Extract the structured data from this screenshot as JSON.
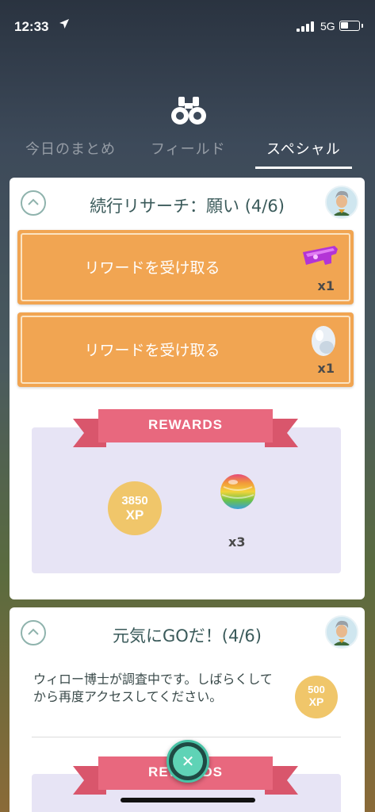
{
  "status_bar": {
    "time": "12:33",
    "network": "5G"
  },
  "tabs": [
    {
      "label": "今日のまとめ"
    },
    {
      "label": "フィールド"
    },
    {
      "label": "スペシャル"
    }
  ],
  "card1": {
    "title": "続行リサーチ：願い (4/6)",
    "rewards_buttons": [
      {
        "label": "リワードを受け取る",
        "qty": "x1",
        "item_icon": "incense-icon"
      },
      {
        "label": "リワードを受け取る",
        "qty": "x1",
        "item_icon": "egg-icon"
      }
    ],
    "rewards_label": "REWARDS",
    "xp": {
      "amount": "3850",
      "unit": "XP"
    },
    "candy": {
      "qty": "x3",
      "icon": "rare-candy-icon"
    }
  },
  "card2": {
    "title": "元気にGOだ！(4/6)",
    "description": "ウィロー博士が調査中です。しばらくしてから再度アクセスしてください。",
    "xp": {
      "amount": "500",
      "unit": "XP"
    },
    "rewards_label": "REWARDS"
  },
  "colors": {
    "accent_orange": "#f1a552",
    "ribbon_pink": "#e8687e",
    "panel_lavender": "#e7e4f5",
    "xp_gold": "#f0c66a",
    "teal": "#48c3a6"
  }
}
